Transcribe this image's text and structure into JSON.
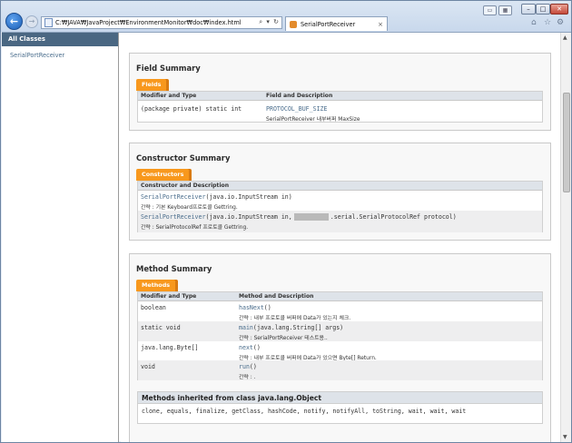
{
  "browser": {
    "url": "C:₩JAVA₩JavaProject₩EnvironmentMonitor₩doc₩index.html",
    "tab_title": "SerialPortReceiver",
    "tab_close": "×",
    "controls": {
      "minimize": "–",
      "maximize": "□",
      "close": "✕"
    },
    "back_glyph": "←",
    "forward_glyph": "→",
    "address_tools": "⌕ ▾ ↻",
    "toolbar_icons": {
      "home": "⌂",
      "favorites": "☆",
      "settings": "⚙"
    }
  },
  "left_frame": {
    "header": "All Classes",
    "classes": [
      "SerialPortReceiver"
    ]
  },
  "field_summary": {
    "title": "Field Summary",
    "caption": "Fields",
    "headers": [
      "Modifier and Type",
      "Field and Description"
    ],
    "rows": [
      {
        "modifier": "(package private) static int",
        "name": "PROTOCOL_BUF_SIZE",
        "desc": "SerialPortReceiver 내부버퍼 MaxSize"
      }
    ]
  },
  "constructor_summary": {
    "title": "Constructor Summary",
    "caption": "Constructors",
    "header": "Constructor and Description",
    "rows": [
      {
        "name": "SerialPortReceiver",
        "params": "(java.io.InputStream in)",
        "desc": "간략 : 기본 Keyboard프로토콜 Gettring."
      },
      {
        "name": "SerialPortReceiver",
        "params": "(java.io.InputStream in,",
        "params_after": ".serial.SerialProtocolRef protocol)",
        "desc": "간략 : SerialProtocolRef 프로토콜 Gettring."
      }
    ]
  },
  "method_summary": {
    "title": "Method Summary",
    "caption": "Methods",
    "headers": [
      "Modifier and Type",
      "Method and Description"
    ],
    "rows": [
      {
        "modifier": "boolean",
        "name": "hasNext",
        "params": "()",
        "desc": "간략 : 내부 프로토콜 버퍼에 Data가 있는지 체크."
      },
      {
        "modifier": "static void",
        "name": "main",
        "params": "(java.lang.String[] args)",
        "desc": "간략 : SerialPortReceiver 테스트용.."
      },
      {
        "modifier": "java.lang.Byte[]",
        "name": "next",
        "params": "()",
        "desc": "간략 : 내부 프로토콜 버퍼에 Data가 있으면 Byte[] Return."
      },
      {
        "modifier": "void",
        "name": "run",
        "params": "()",
        "desc": "간략 : ."
      }
    ],
    "inherited_title": "Methods inherited from class java.lang.Object",
    "inherited_list": "clone, equals, finalize, getClass, hashCode, notify, notifyAll, toString, wait, wait, wait"
  }
}
